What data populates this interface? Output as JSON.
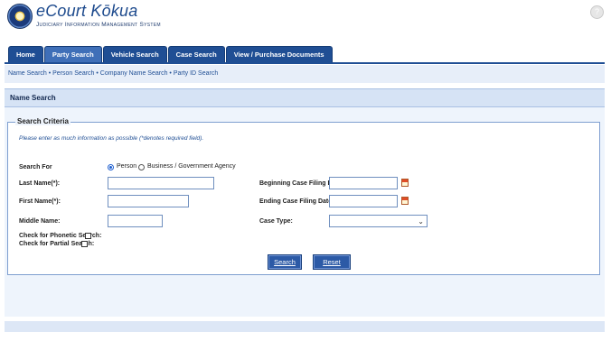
{
  "header": {
    "app_title": "eCourt Kōkua",
    "subtitle": "Judiciary Information Management System",
    "help_glyph": "?"
  },
  "tabs": [
    {
      "label": "Home",
      "active": false
    },
    {
      "label": "Party Search",
      "active": true
    },
    {
      "label": "Vehicle Search",
      "active": false
    },
    {
      "label": "Case Search",
      "active": false
    },
    {
      "label": "View / Purchase Documents",
      "active": false
    }
  ],
  "breadcrumb": "Name Search • Person Search • Company Name Search • Party ID Search",
  "panel_title": "Name Search",
  "criteria": {
    "legend": "Search Criteria",
    "note": "Please enter as much information as possible (*denotes required field).",
    "search_for_label": "Search For",
    "option_person": "Person",
    "option_business": "Business / Government Agency",
    "last_name_label": "Last Name(*):",
    "first_name_label": "First Name(*):",
    "middle_name_label": "Middle Name:",
    "phonetic_label": "Check for Phonetic Search:",
    "partial_label": "Check for Partial Search:",
    "begin_date_label": "Beginning Case Filing Date:",
    "end_date_label": "Ending Case Filing Date:",
    "case_type_label": "Case Type:",
    "last_name_value": "",
    "first_name_value": "",
    "middle_name_value": "",
    "begin_date_value": "",
    "end_date_value": "",
    "case_type_value": ""
  },
  "buttons": {
    "search": "Search",
    "reset": "Reset"
  },
  "colors": {
    "brand_blue": "#1f4e94",
    "panel_bg": "#eef4fc"
  }
}
